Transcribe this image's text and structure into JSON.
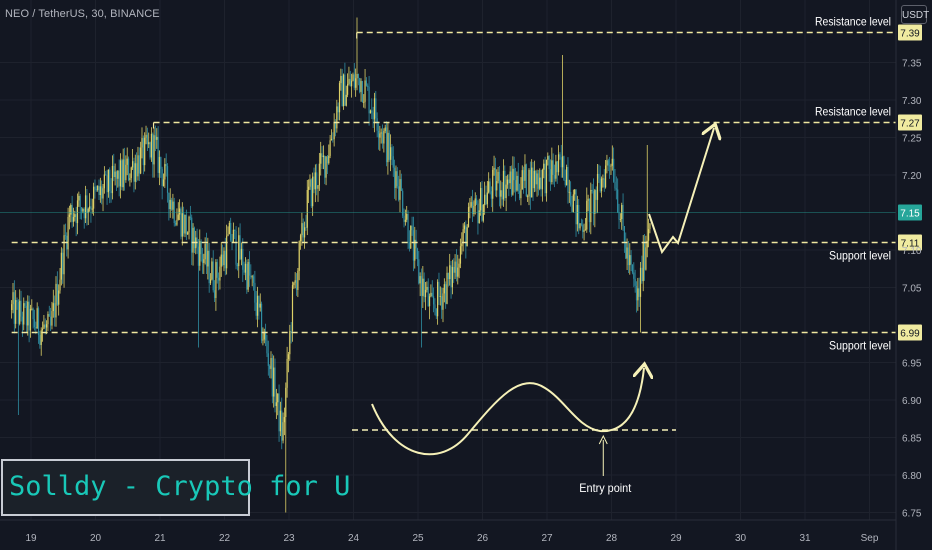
{
  "header": {
    "symbol_label": "NEO / TetherUS, 30, BINANCE"
  },
  "axis": {
    "unit": "USDT"
  },
  "watermark": {
    "text": "Solldy - Crypto for U"
  },
  "colors": {
    "background": "#131722",
    "grid": "#1e222d",
    "up_candle": "#ddd067",
    "down_candle": "#2f8ea3",
    "level_line": "#f0e8a0",
    "annotation": "#f6f1b8",
    "axis_text": "#b2b5be",
    "price_badge": "#f0eba0",
    "current_line": "#26a69a"
  },
  "chart_data": {
    "type": "candlestick",
    "title": "NEO / TetherUS, 30, BINANCE",
    "xlabel": "",
    "ylabel": "USDT",
    "x_ticks": [
      "19",
      "20",
      "21",
      "22",
      "23",
      "24",
      "25",
      "26",
      "27",
      "28",
      "29",
      "30",
      "31",
      "Sep"
    ],
    "y_ticks": [
      "6.75",
      "6.80",
      "6.85",
      "6.90",
      "6.95",
      "7.05",
      "7.10",
      "7.20",
      "7.25",
      "7.30",
      "7.35"
    ],
    "ylim": [
      6.74,
      7.42
    ],
    "grid": true,
    "levels": [
      {
        "name": "Resistance level",
        "value": 7.39,
        "badge": "7.39",
        "from_day": 24.05
      },
      {
        "name": "Resistance level",
        "value": 7.27,
        "badge": "7.27",
        "from_day": 20.9
      },
      {
        "name": "Support level",
        "value": 7.11,
        "badge": "7.11",
        "from_day": 18.7
      },
      {
        "name": "Support level",
        "value": 6.99,
        "badge": "6.99",
        "from_day": 18.7
      }
    ],
    "current_price": {
      "value": 7.15,
      "badge": "7.15"
    },
    "annotations": [
      {
        "text": "Entry point",
        "day": 27.95,
        "value": 6.86
      }
    ],
    "anchors": [
      {
        "day": 18.7,
        "value": 7.02
      },
      {
        "day": 19.3,
        "value": 6.99
      },
      {
        "day": 19.6,
        "value": 7.15
      },
      {
        "day": 20.0,
        "value": 7.17
      },
      {
        "day": 20.3,
        "value": 7.19
      },
      {
        "day": 20.55,
        "value": 7.21
      },
      {
        "day": 20.9,
        "value": 7.24
      },
      {
        "day": 21.2,
        "value": 7.16
      },
      {
        "day": 21.55,
        "value": 7.11
      },
      {
        "day": 21.85,
        "value": 7.06
      },
      {
        "day": 22.1,
        "value": 7.12
      },
      {
        "day": 22.4,
        "value": 7.06
      },
      {
        "day": 22.7,
        "value": 6.95
      },
      {
        "day": 22.9,
        "value": 6.85
      },
      {
        "day": 23.05,
        "value": 7.03
      },
      {
        "day": 23.3,
        "value": 7.17
      },
      {
        "day": 23.6,
        "value": 7.23
      },
      {
        "day": 23.8,
        "value": 7.31
      },
      {
        "day": 24.1,
        "value": 7.33
      },
      {
        "day": 24.4,
        "value": 7.27
      },
      {
        "day": 24.7,
        "value": 7.19
      },
      {
        "day": 25.0,
        "value": 7.07
      },
      {
        "day": 25.2,
        "value": 7.02
      },
      {
        "day": 25.5,
        "value": 7.06
      },
      {
        "day": 25.8,
        "value": 7.14
      },
      {
        "day": 26.2,
        "value": 7.19
      },
      {
        "day": 26.6,
        "value": 7.19
      },
      {
        "day": 26.95,
        "value": 7.2
      },
      {
        "day": 27.3,
        "value": 7.21
      },
      {
        "day": 27.5,
        "value": 7.13
      },
      {
        "day": 27.75,
        "value": 7.17
      },
      {
        "day": 28.0,
        "value": 7.23
      },
      {
        "day": 28.2,
        "value": 7.11
      },
      {
        "day": 28.4,
        "value": 7.03
      },
      {
        "day": 28.55,
        "value": 7.12
      },
      {
        "day": 28.6,
        "value": 7.15
      }
    ],
    "spikes": [
      {
        "day": 22.95,
        "value": 6.75
      },
      {
        "day": 24.05,
        "value": 7.41
      },
      {
        "day": 25.05,
        "value": 6.97
      },
      {
        "day": 27.25,
        "value": 7.36
      },
      {
        "day": 28.45,
        "value": 6.99
      },
      {
        "day": 28.55,
        "value": 7.24
      },
      {
        "day": 21.6,
        "value": 6.97
      },
      {
        "day": 18.8,
        "value": 6.88
      },
      {
        "day": 22.65,
        "value": 6.98
      }
    ]
  }
}
